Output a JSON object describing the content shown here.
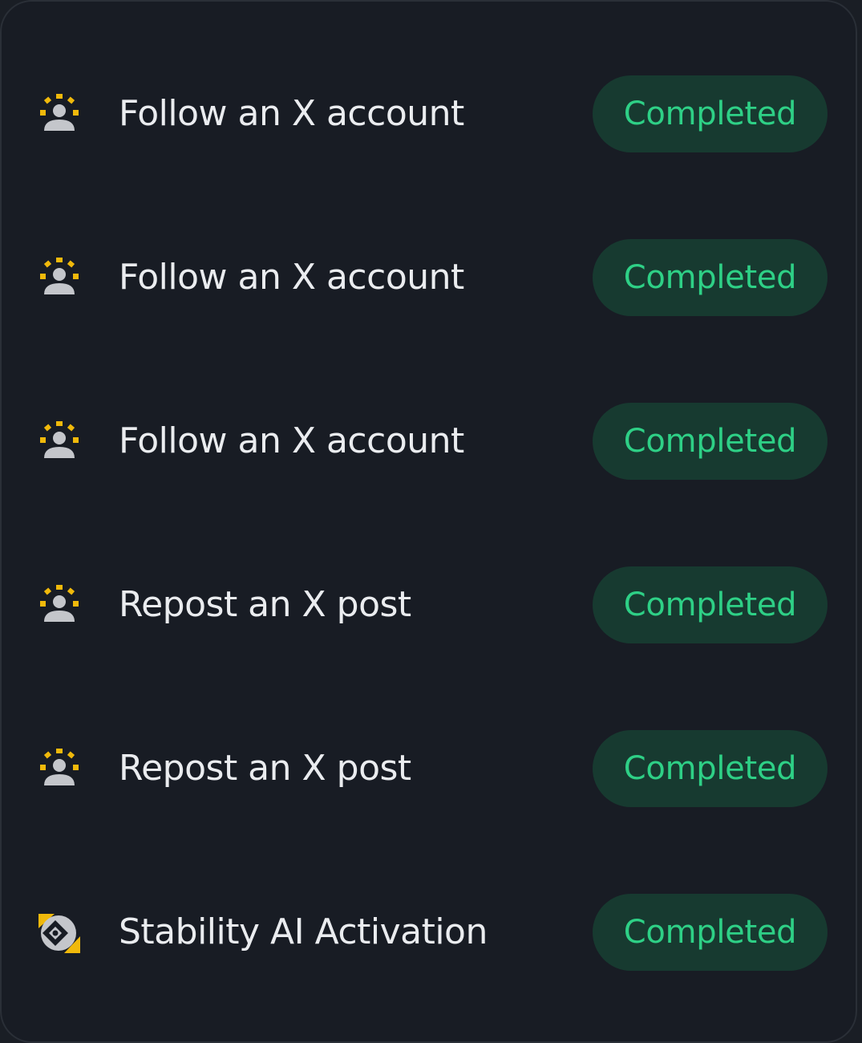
{
  "colors": {
    "background": "#181c24",
    "text": "#eaecef",
    "status_bg": "#173a30",
    "status_text": "#2ed086",
    "icon_accent": "#f0b90b",
    "icon_gray": "#c4c6cb"
  },
  "tasks": [
    {
      "icon": "user-sparkle-icon",
      "label": "Follow an X account",
      "status": "Completed"
    },
    {
      "icon": "user-sparkle-icon",
      "label": "Follow an X account",
      "status": "Completed"
    },
    {
      "icon": "user-sparkle-icon",
      "label": "Follow an X account",
      "status": "Completed"
    },
    {
      "icon": "user-sparkle-icon",
      "label": "Repost an X post",
      "status": "Completed"
    },
    {
      "icon": "user-sparkle-icon",
      "label": "Repost an X post",
      "status": "Completed"
    },
    {
      "icon": "stability-ai-logo-icon",
      "label": "Stability AI Activation",
      "status": "Completed"
    }
  ]
}
